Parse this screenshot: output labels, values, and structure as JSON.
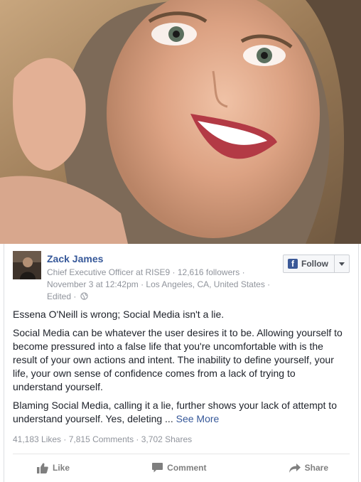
{
  "post": {
    "photo_alt": "photo",
    "author": "Zack James",
    "meta_line1": "Chief Executive Officer at RISE9 · 12,616 followers ·",
    "meta_line2": "November 3 at 12:42pm · Los Angeles, CA, United States ·",
    "meta_line3": "Edited ·",
    "follow_label": "Follow",
    "paragraphs": [
      "Essena O'Neill is wrong; Social Media isn't a lie.",
      "Social Media can be whatever the user desires it to be. Allowing yourself to become pressured into a false life that you're uncomfortable with is the result of your own actions and intent. The inability to define yourself, your life, your own sense of confidence comes from a lack of trying to understand yourself.",
      "Blaming Social Media, calling it a lie, further shows your lack of attempt to understand yourself. Yes, deleting ..."
    ],
    "see_more": "See More",
    "stats": "41,183 Likes · 7,815 Comments · 3,702 Shares"
  },
  "actions": {
    "like": "Like",
    "comment": "Comment",
    "share": "Share"
  },
  "icons": {
    "facebook": "facebook-f-icon",
    "globe": "globe-icon",
    "like": "thumbs-up-icon",
    "comment": "comment-bubble-icon",
    "share": "share-arrow-icon"
  },
  "colors": {
    "link": "#365899",
    "muted": "#90949c",
    "brand": "#3b5998"
  }
}
